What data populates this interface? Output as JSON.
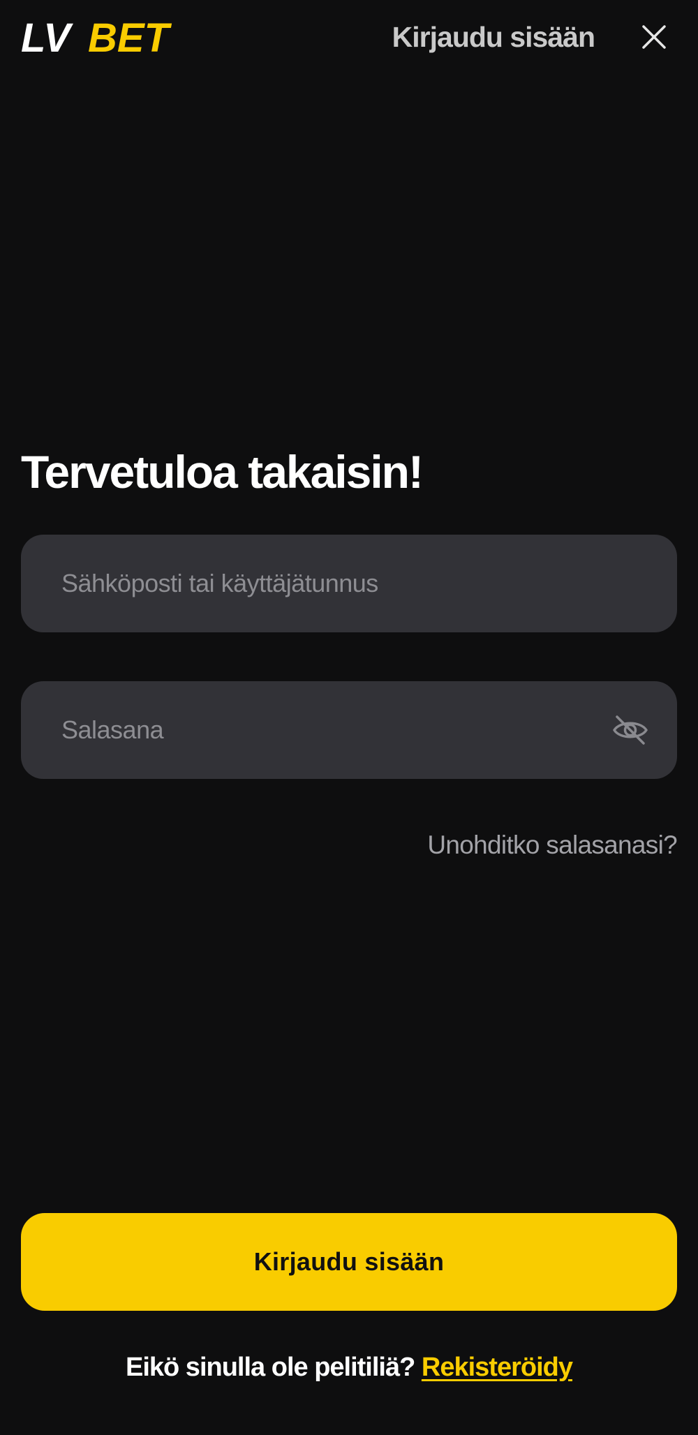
{
  "header": {
    "logo": {
      "text_lv": "LV",
      "text_bet": "BET",
      "color_primary": "#ffffff",
      "color_accent": "#f9cc00"
    },
    "title": "Kirjaudu sisään",
    "close_icon": "close-icon"
  },
  "welcome_title": "Tervetuloa takaisin!",
  "form": {
    "email": {
      "placeholder": "Sähköposti tai käyttäjätunnus",
      "value": ""
    },
    "password": {
      "placeholder": "Salasana",
      "value": "",
      "toggle_icon": "eye-off-icon"
    },
    "forgot_label": "Unohditko salasanasi?",
    "submit_label": "Kirjaudu sisään"
  },
  "register": {
    "prompt": "Eikö sinulla ole pelitiliä?",
    "link_label": "Rekisteröidy"
  },
  "colors": {
    "background": "#0e0e0f",
    "field_bg": "#323237",
    "accent": "#f9cc00",
    "muted_text": "#a3a3a8"
  }
}
